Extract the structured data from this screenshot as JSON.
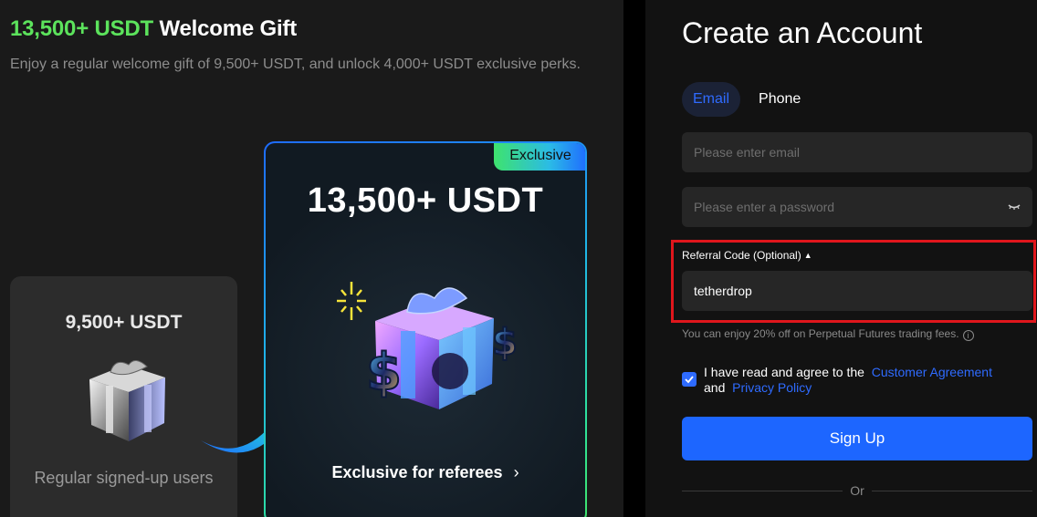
{
  "promo": {
    "title_accent": "13,500+ USDT",
    "title_rest": " Welcome Gift",
    "description": "Enjoy a regular welcome gift of 9,500+ USDT, and unlock 4,000+ USDT exclusive perks."
  },
  "card_regular": {
    "amount": "9,500+ USDT",
    "caption": "Regular signed-up users"
  },
  "card_exclusive": {
    "badge": "Exclusive",
    "amount": "13,500+ USDT",
    "cta": "Exclusive for referees",
    "cta_icon": "chevron-right-icon"
  },
  "form": {
    "title": "Create an Account",
    "tabs": [
      {
        "label": "Email",
        "active": true
      },
      {
        "label": "Phone",
        "active": false
      }
    ],
    "email_placeholder": "Please enter email",
    "password_placeholder": "Please enter a password",
    "referral_label": "Referral Code (Optional)",
    "referral_value": "tetherdrop",
    "referral_hint": "You can enjoy 20% off on Perpetual Futures trading fees.",
    "agree_prefix": "I have read and agree to the",
    "agree_link1": "Customer Agreement",
    "agree_and": "and",
    "agree_link2": "Privacy Policy",
    "checkbox_checked": true,
    "signup_label": "Sign Up",
    "or_text": "Or"
  },
  "colors": {
    "accent_green": "#5ce35c",
    "primary_blue": "#1d66ff",
    "highlight_red": "#e0161c"
  }
}
